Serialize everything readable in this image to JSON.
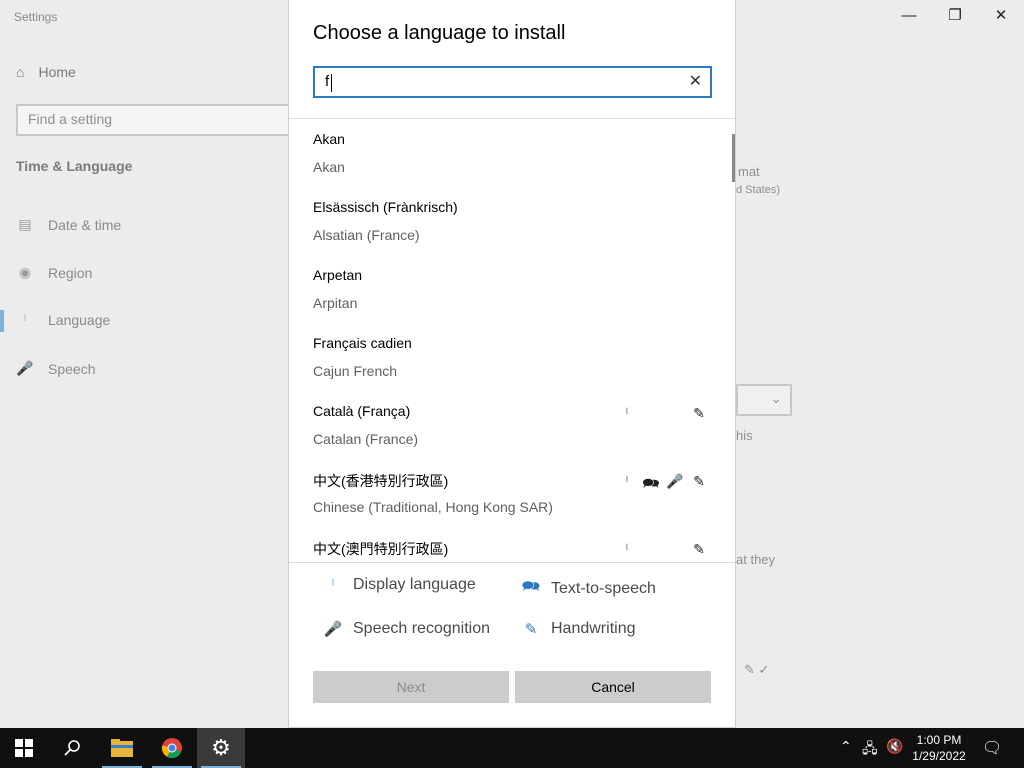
{
  "settings": {
    "window_title": "Settings",
    "home_label": "Home",
    "find_placeholder": "Find a setting",
    "section_title": "Time & Language",
    "nav": [
      {
        "label": "Date & time",
        "icon": "calendar-clock-icon"
      },
      {
        "label": "Region",
        "icon": "globe-icon"
      },
      {
        "label": "Language",
        "icon": "language-icon"
      },
      {
        "label": "Speech",
        "icon": "microphone-icon"
      }
    ],
    "background_fragments": [
      "mat",
      "d States)",
      "his",
      "at they"
    ]
  },
  "dialog": {
    "title": "Choose a language to install",
    "search_value": "f",
    "languages": [
      {
        "native": "Akan",
        "english": "Akan",
        "features": []
      },
      {
        "native": "Elsässisch (Frànkrisch)",
        "english": "Alsatian (France)",
        "features": []
      },
      {
        "native": "Arpetan",
        "english": "Arpitan",
        "features": []
      },
      {
        "native": "Français cadien",
        "english": "Cajun French",
        "features": []
      },
      {
        "native": "Català (França)",
        "english": "Catalan (France)",
        "features": [
          "display",
          "handwriting"
        ]
      },
      {
        "native": "中文(香港特別行政區)",
        "english": "Chinese (Traditional, Hong Kong SAR)",
        "features": [
          "display",
          "tts",
          "speech",
          "handwriting"
        ]
      },
      {
        "native": "中文(澳門特別行政區)",
        "english": "",
        "features": [
          "display",
          "handwriting"
        ]
      }
    ],
    "legend": {
      "display": "Display language",
      "tts": "Text-to-speech",
      "speech": "Speech recognition",
      "handwriting": "Handwriting"
    },
    "buttons": {
      "next": "Next",
      "cancel": "Cancel"
    }
  },
  "taskbar": {
    "time": "1:00 PM",
    "date": "1/29/2022"
  },
  "colors": {
    "accent": "#2b79c2",
    "taskbar": "#101010"
  }
}
